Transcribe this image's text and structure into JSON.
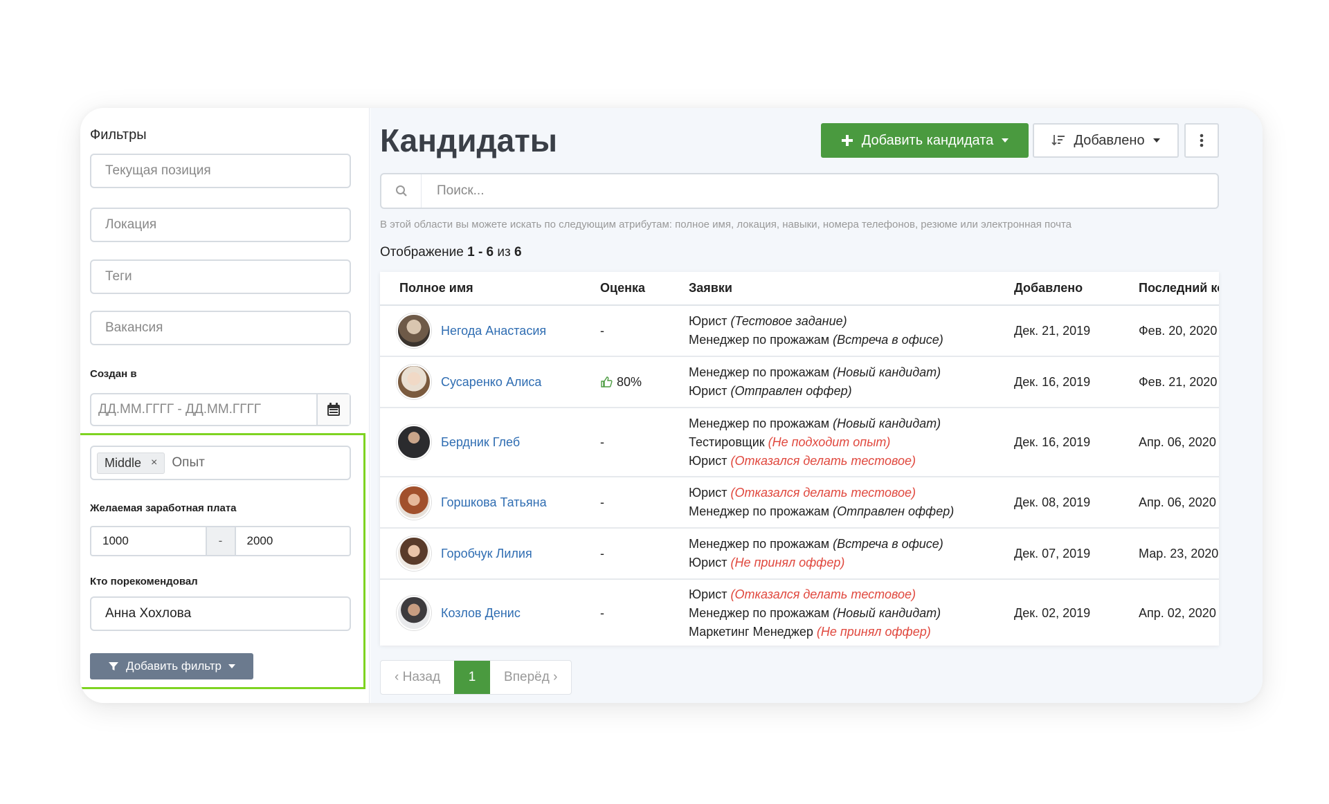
{
  "filters": {
    "title": "Фильтры",
    "current_position_placeholder": "Текущая позиция",
    "location_placeholder": "Локация",
    "tags_placeholder": "Теги",
    "vacancy_placeholder": "Вакансия",
    "created_label": "Создан в",
    "date_placeholder": "ДД.ММ.ГГГГ - ДД.ММ.ГГГГ",
    "experience_tag": "Middle",
    "experience_tag_remove": "×",
    "experience_placeholder": "Опыт",
    "salary_label": "Желаемая заработная плата",
    "salary_from": "1000",
    "salary_sep": "-",
    "salary_to": "2000",
    "referred_label": "Кто порекомендовал",
    "referred_value": "Анна Хохлова",
    "add_filter_label": "Добавить фильтр"
  },
  "header": {
    "title": "Кандидаты",
    "add_candidate_label": "Добавить кандидата",
    "sort_label": "Добавлено"
  },
  "search": {
    "placeholder": "Поиск...",
    "hint": "В этой области вы можете искать по следующим атрибутам: полное имя, локация, навыки, номера телефонов, резюме или электронная почта"
  },
  "showing": {
    "prefix": "Отображение",
    "range": "1 - 6",
    "of": "из",
    "total": "6"
  },
  "table": {
    "columns": [
      "Полное имя",
      "Оценка",
      "Заявки",
      "Добавлено",
      "Последний контакт"
    ],
    "rows": [
      {
        "name": "Негода Анастасия",
        "rating": "-",
        "added": "Дек. 21, 2019",
        "last_contact": "Фев. 20, 2020",
        "apps": [
          {
            "role": "Юрист",
            "status": "(Тестовое задание)"
          },
          {
            "role": "Менеджер по прожажам",
            "status": "(Встреча в офисе)"
          }
        ]
      },
      {
        "name": "Сусаренко Алиса",
        "rating": "80%",
        "added": "Дек. 16, 2019",
        "last_contact": "Фев. 21, 2020",
        "apps": [
          {
            "role": "Менеджер по прожажам",
            "status": "(Новый кандидат)"
          },
          {
            "role": "Юрист",
            "status": "(Отправлен оффер)"
          }
        ]
      },
      {
        "name": "Бердник Глеб",
        "rating": "-",
        "added": "Дек. 16, 2019",
        "last_contact": "Апр. 06, 2020",
        "apps": [
          {
            "role": "Менеджер по прожажам",
            "status": "(Новый кандидат)"
          },
          {
            "role": "Тестировщик",
            "status": "(Не подходит опыт)"
          },
          {
            "role": "Юрист",
            "status": "(Отказался делать тестовое)"
          }
        ]
      },
      {
        "name": "Горшкова Татьяна",
        "rating": "-",
        "added": "Дек. 08, 2019",
        "last_contact": "Апр. 06, 2020",
        "apps": [
          {
            "role": "Юрист",
            "status": "(Отказался делать тестовое)"
          },
          {
            "role": "Менеджер по прожажам",
            "status": "(Отправлен оффер)"
          }
        ]
      },
      {
        "name": "Горобчук Лилия",
        "rating": "-",
        "added": "Дек. 07, 2019",
        "last_contact": "Мар. 23, 2020",
        "apps": [
          {
            "role": "Менеджер по прожажам",
            "status": "(Встреча в офисе)"
          },
          {
            "role": "Юрист",
            "status": "(Не принял оффер)"
          }
        ]
      },
      {
        "name": "Козлов Денис",
        "rating": "-",
        "added": "Дек. 02, 2019",
        "last_contact": "Апр. 02, 2020",
        "apps": [
          {
            "role": "Юрист",
            "status": "(Отказался делать тестовое)"
          },
          {
            "role": "Менеджер по прожажам",
            "status": "(Новый кандидат)"
          },
          {
            "role": "Маркетинг Менеджер",
            "status": "(Не принял оффер)"
          }
        ]
      }
    ]
  },
  "pagination": {
    "prev": "‹ Назад",
    "current": "1",
    "next": "Вперёд ›"
  },
  "colors": {
    "primary_green": "#4a9a3f",
    "link_blue": "#2f6db2",
    "negative_status": "#e0483e",
    "highlight_border": "#7ed321"
  }
}
